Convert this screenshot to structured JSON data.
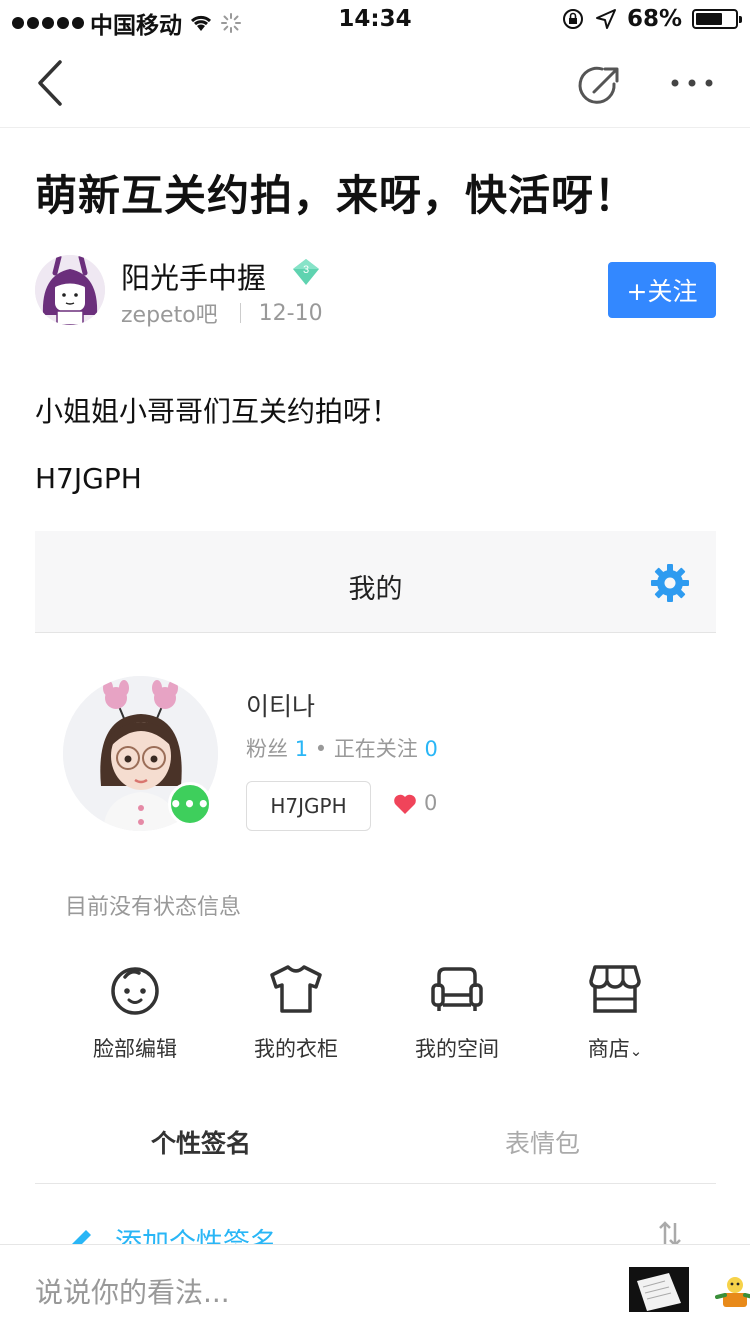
{
  "status_bar": {
    "carrier": "中国移动",
    "time": "14:34",
    "battery_percent": "68%",
    "battery_level": 0.68
  },
  "nav": {
    "back_icon": "chevron-left-icon",
    "share_icon": "share-icon",
    "more_icon": "more-icon"
  },
  "post": {
    "title": "萌新互关约拍，来呀，快活呀！",
    "author": {
      "name": "阳光手中握",
      "level": "3",
      "forum": "zepeto吧",
      "date": "12-10",
      "follow_label": "+关注"
    },
    "body_line1": "小姐姐小哥哥们互关约拍呀！",
    "body_line2": "H7JGPH"
  },
  "embed": {
    "header_title": "我的",
    "profile": {
      "name": "이티나",
      "followers_label": "粉丝",
      "followers": "1",
      "following_label": "正在关注",
      "following": "0",
      "code": "H7JGPH",
      "likes": "0"
    },
    "status_text": "目前没有状态信息",
    "menu": [
      {
        "label": "脸部编辑",
        "icon": "face-icon"
      },
      {
        "label": "我的衣柜",
        "icon": "shirt-icon"
      },
      {
        "label": "我的空间",
        "icon": "sofa-icon"
      },
      {
        "label": "商店",
        "icon": "store-icon"
      }
    ],
    "tabs": {
      "active": "个性签名",
      "inactive": "表情包"
    },
    "add_signature": "添加个性签名"
  },
  "bottom": {
    "comment_placeholder": "说说你的看法..."
  },
  "colors": {
    "accent_blue": "#3388ff",
    "zepeto_blue": "#29b6f6",
    "green_badge": "#3ecf5c",
    "heart_red": "#f0445a"
  }
}
